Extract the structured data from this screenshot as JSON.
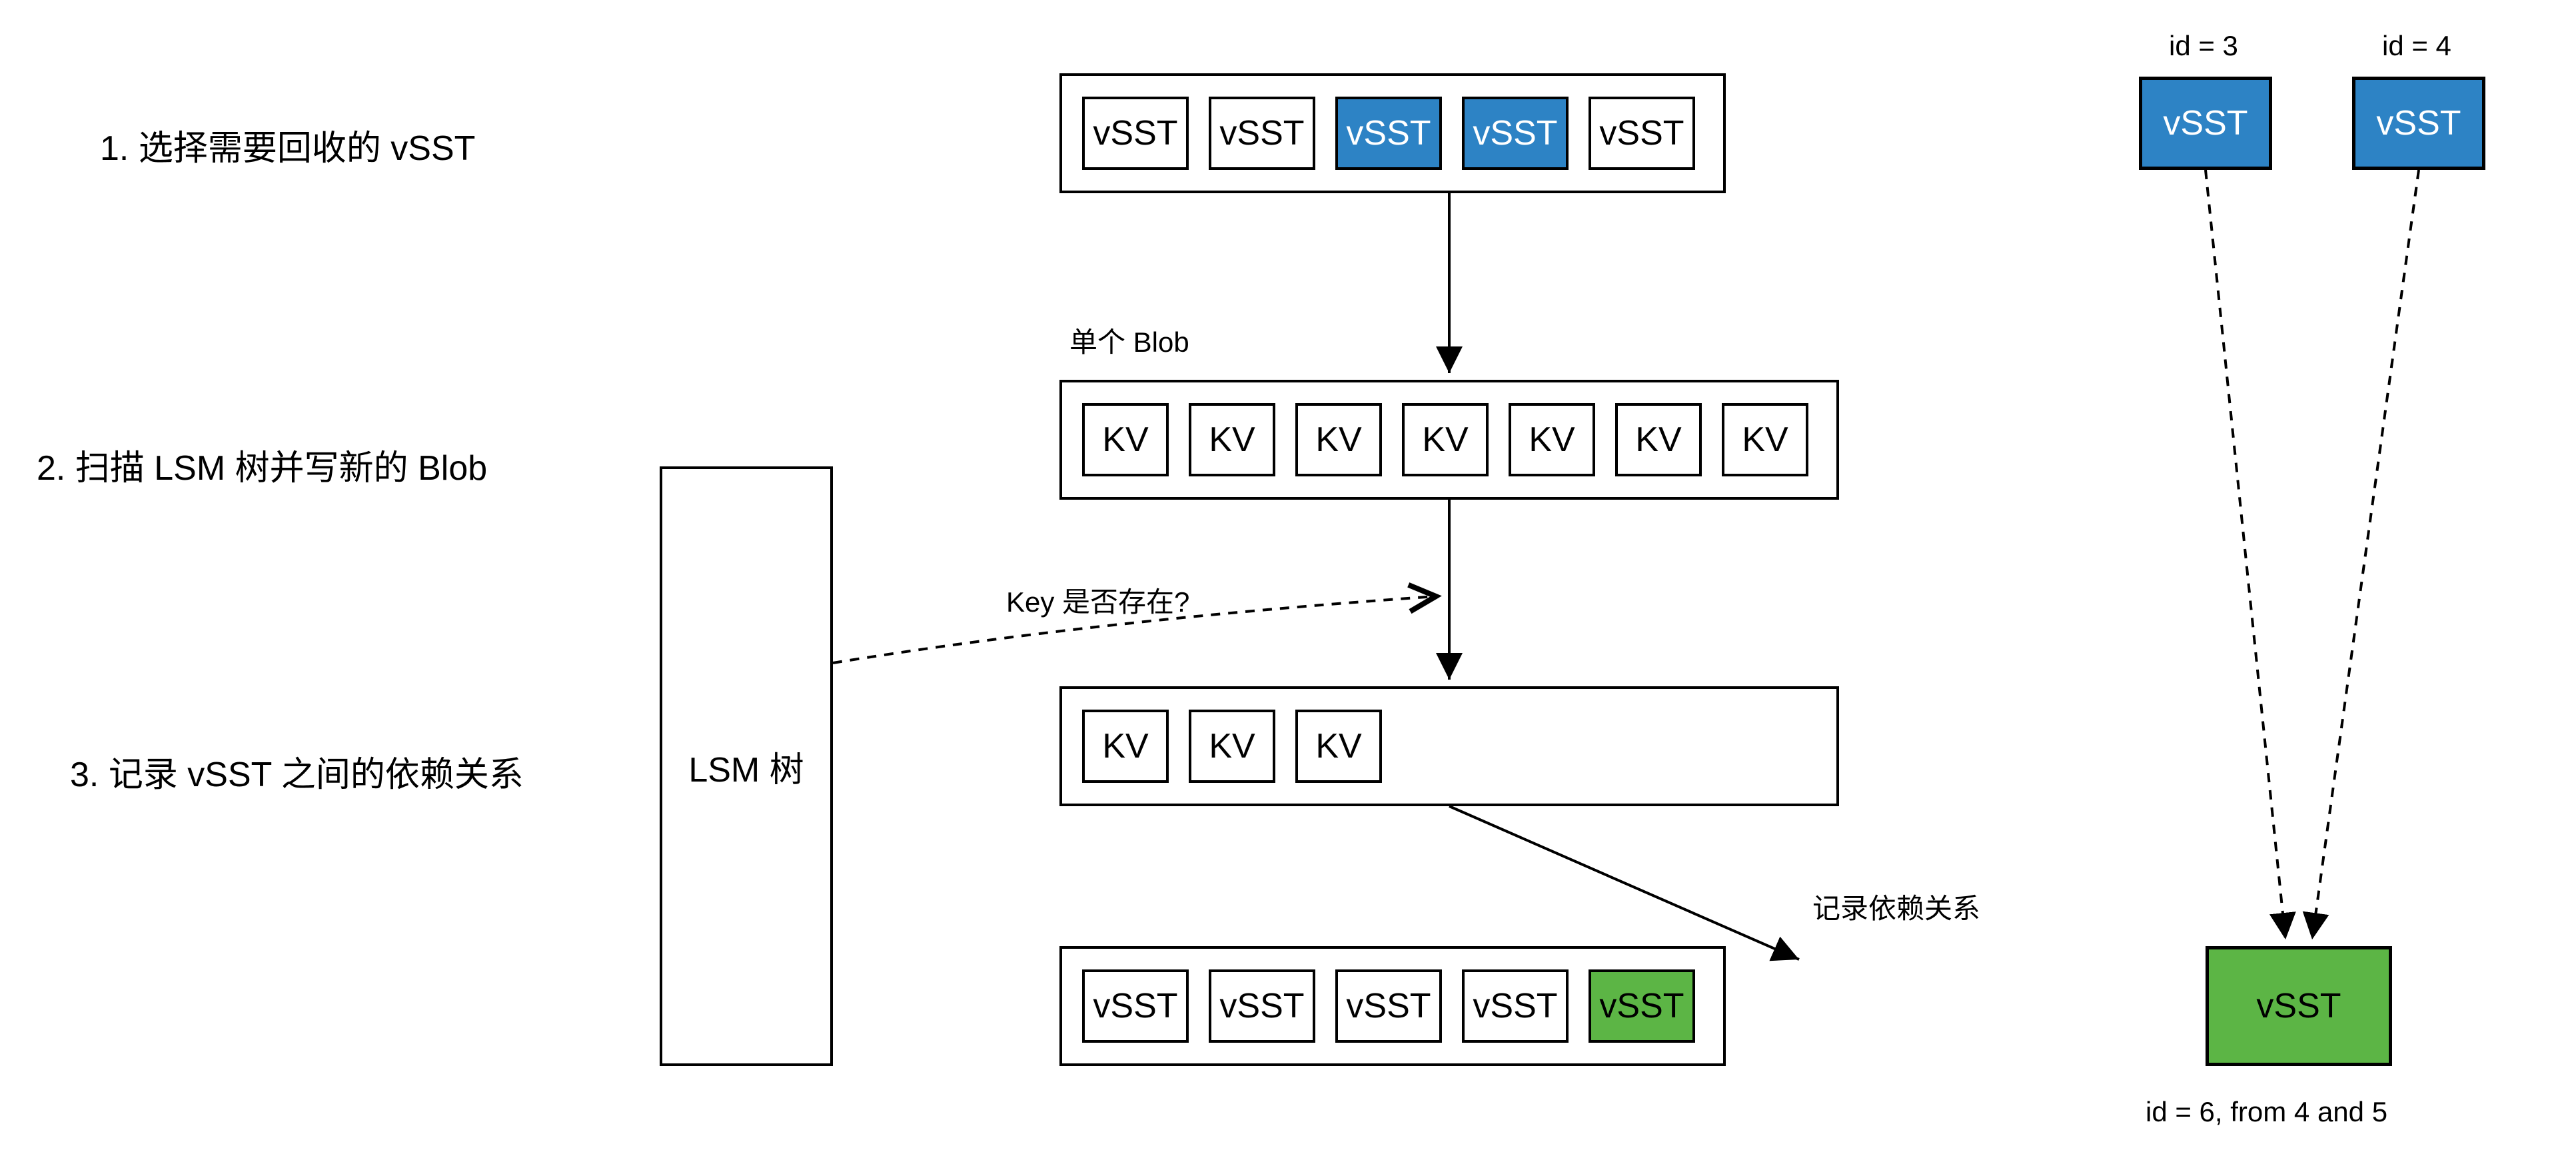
{
  "steps": {
    "s1": "1. 选择需要回收的 vSST",
    "s2": "2. 扫描 LSM 树并写新的 Blob",
    "s3": "3. 记录 vSST 之间的依赖关系"
  },
  "labels": {
    "single_blob": "单个 Blob",
    "key_exists": "Key 是否存在?",
    "record_deps": "记录依赖关系",
    "id3": "id = 3",
    "id4": "id = 4",
    "footer": "id = 6, from 4 and 5"
  },
  "lsm": "LSM 树",
  "row1": {
    "b0": "vSST",
    "b1": "vSST",
    "b2": "vSST",
    "b3": "vSST",
    "b4": "vSST"
  },
  "row2": {
    "b0": "KV",
    "b1": "KV",
    "b2": "KV",
    "b3": "KV",
    "b4": "KV",
    "b5": "KV",
    "b6": "KV"
  },
  "row3": {
    "b0": "KV",
    "b1": "KV",
    "b2": "KV"
  },
  "row4": {
    "b0": "vSST",
    "b1": "vSST",
    "b2": "vSST",
    "b3": "vSST",
    "b4": "vSST"
  },
  "side": {
    "top1": "vSST",
    "top2": "vSST",
    "bottom": "vSST"
  }
}
